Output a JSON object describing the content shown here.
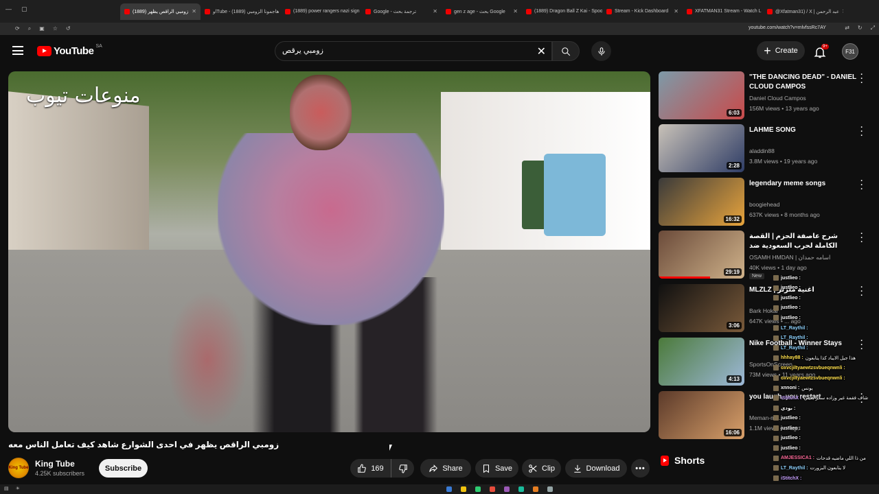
{
  "browser": {
    "tabs": [
      {
        "label": "زومبي الراقص يظهر (1889)",
        "active": true
      },
      {
        "label": "اوTube - هاجمونا الزومبي (1889)",
        "active": false
      },
      {
        "label": "(1889) power rangers nazi sign",
        "active": false
      },
      {
        "label": "Google - ترجمة بحث",
        "active": false
      },
      {
        "label": "gen z age - بحث Google",
        "active": false
      },
      {
        "label": "(1889) Dragon Ball Z Kai - Spoo",
        "active": false
      },
      {
        "label": "Stream - Kick Dashboard",
        "active": false
      },
      {
        "label": "XFATMAN31 Stream - Watch L",
        "active": false
      },
      {
        "label": "@Xfatman31) / X | عبد الرحمن",
        "active": false
      }
    ],
    "url": "youtube.com/watch?v=mlvfssRc7AY"
  },
  "header": {
    "logo_text": "YouTube",
    "country": "SA",
    "search_query": "زومبي يرقص",
    "create_label": "Create",
    "notif_count": "9+",
    "avatar_initials": "F31"
  },
  "video": {
    "watermark": "منوعات تيوب",
    "title": "زومبي الراقص يظهر في احدى الشوارع شاهد كيف تعامل الناس معه",
    "channel_name": "King Tube",
    "channel_avatar_text": "King Tube",
    "subscribers": "4.25K subscribers",
    "subscribe_label": "Subscribe",
    "likes": "169",
    "share_label": "Share",
    "save_label": "Save",
    "clip_label": "Clip",
    "download_label": "Download"
  },
  "recommendations": [
    {
      "title": "\"THE DANCING DEAD\" - DANIEL CLOUD CAMPOS",
      "channel": "Daniel Cloud Campos",
      "meta": "156M views • 13 years ago",
      "duration": "6:03",
      "colors": [
        "#7d9aa8",
        "#c94a4a"
      ]
    },
    {
      "title": "LAHME SONG",
      "channel": "aladdin88",
      "meta": "3.8M views • 19 years ago",
      "duration": "2:28",
      "colors": [
        "#c9c2b8",
        "#2f3d66"
      ]
    },
    {
      "title": "legendary meme songs",
      "channel": "boogiehead",
      "meta": "637K views • 8 months ago",
      "duration": "16:32",
      "colors": [
        "#3a3a3a",
        "#e8a43c"
      ]
    },
    {
      "title": "شرح عاصفة الحزم | القصة الكاملة لحرب السعودية ضد الحوثي..",
      "channel": "OSAMH HMDAN | اسامه حمدان",
      "meta": "40K views • 1 day ago",
      "duration": "29:19",
      "badge": "New",
      "colors": [
        "#6b4b3a",
        "#cfb28a"
      ]
    },
    {
      "title": "MLZLZ | اغنية ملزلز",
      "channel": "Bark Hokal",
      "meta": "647K views • ... ago",
      "duration": "3:06",
      "colors": [
        "#101010",
        "#7a5a3a"
      ]
    },
    {
      "title": "Nike Football - Winner Stays",
      "channel": "SportsOnScreen",
      "meta": "73M views • 11 years ago",
      "duration": "4:13",
      "colors": [
        "#4b7a3a",
        "#9db8d8"
      ]
    },
    {
      "title": "you laugh, you restart",
      "channel": "Meman-m...",
      "meta": "1.1M views • ... ago",
      "duration": "16:06",
      "colors": [
        "#5b3a2a",
        "#d9a06a"
      ]
    }
  ],
  "shorts_label": "Shorts",
  "chat": [
    {
      "name": "justlieo :",
      "msg": "",
      "color": "#ffffff"
    },
    {
      "name": "justlieo :",
      "msg": "",
      "color": "#ffffff"
    },
    {
      "name": "justlieo :",
      "msg": "",
      "color": "#ffffff"
    },
    {
      "name": "justlieo :",
      "msg": "",
      "color": "#ffffff"
    },
    {
      "name": "justlieo :",
      "msg": "",
      "color": "#ffffff"
    },
    {
      "name": "LT_Raythil :",
      "msg": "",
      "color": "#8fd3ff"
    },
    {
      "name": "LT_Raythil :",
      "msg": "",
      "color": "#8fd3ff"
    },
    {
      "name": "LT_Raythil :",
      "msg": "",
      "color": "#8fd3ff"
    },
    {
      "name": "hhhay88 :",
      "msg": "هذا جيل الايباد كذا يتابعون",
      "color": "#ffe04d"
    },
    {
      "name": "oxvcjiltyaewtzsvbueqnwnli :",
      "msg": "",
      "color": "#ffe04d"
    },
    {
      "name": "oxvcjiltyaewtzsvbueqnwnli :",
      "msg": "",
      "color": "#ffe04d"
    },
    {
      "name": "xnnoni :",
      "msg": "يونس",
      "color": "#ffffff"
    },
    {
      "name": "iStitchX :",
      "msg": "شاف فقمة غير وزاده سكر بعيني",
      "color": "#c9a2ff"
    },
    {
      "name": "بودي :",
      "msg": "",
      "color": "#ffffff"
    },
    {
      "name": "justlieo :",
      "msg": "",
      "color": "#ffffff"
    },
    {
      "name": "justlieo :",
      "msg": "",
      "color": "#ffffff"
    },
    {
      "name": "justlieo :",
      "msg": "",
      "color": "#ffffff"
    },
    {
      "name": "justlieo :",
      "msg": "",
      "color": "#ffffff"
    },
    {
      "name": "AMJESSICA1 :",
      "msg": "من ذا اللي ماضيه قدحات",
      "color": "#ff6b9a"
    },
    {
      "name": "LT_Raythil :",
      "msg": "لا يتابعون البزورت",
      "color": "#8fd3ff"
    },
    {
      "name": "iStitchX :",
      "msg": "",
      "color": "#c9a2ff"
    }
  ]
}
